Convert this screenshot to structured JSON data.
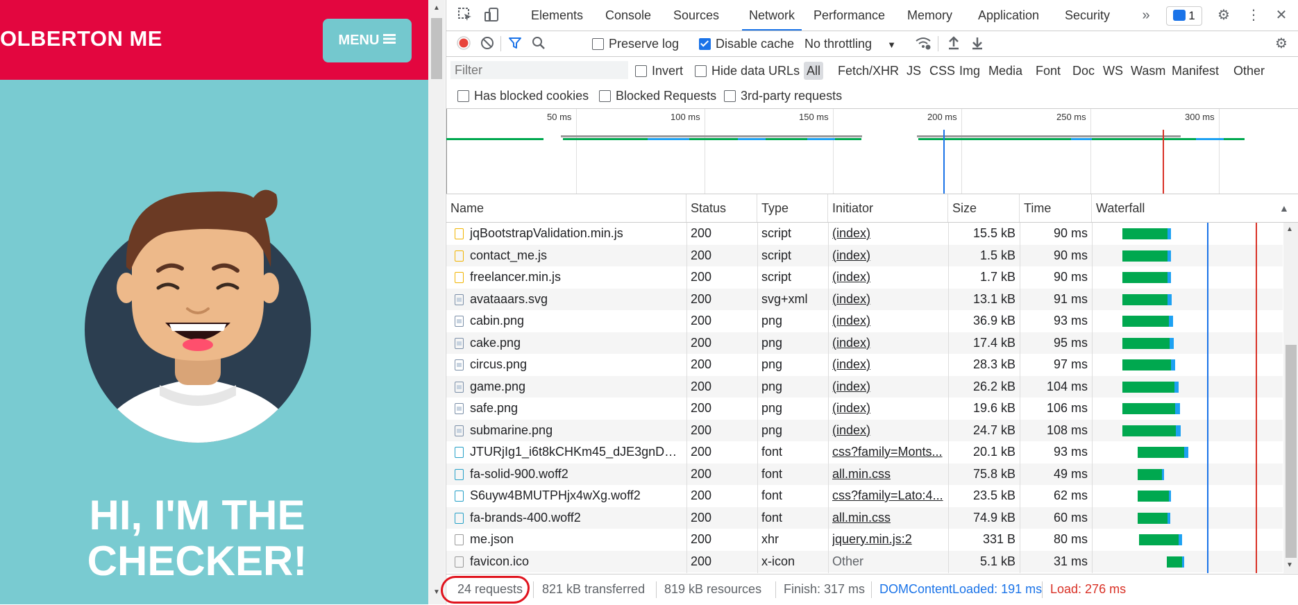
{
  "page": {
    "brand": "OLBERTON ME",
    "menu_label": "MENU",
    "hero_line1": "HI, I'M THE",
    "hero_line2": "CHECKER!",
    "colors": {
      "header": "#e3063f",
      "body": "#79cbd1",
      "menu_button": "#74c8ce"
    }
  },
  "devtools": {
    "tabs": [
      "Elements",
      "Console",
      "Sources",
      "Network",
      "Performance",
      "Memory",
      "Application",
      "Security"
    ],
    "active_tab": "Network",
    "issues_count": "1",
    "toolbar": {
      "preserve_log": "Preserve log",
      "disable_cache": "Disable cache",
      "throttling": "No throttling"
    },
    "filter": {
      "placeholder": "Filter",
      "invert": "Invert",
      "hide_data_urls": "Hide data URLs",
      "types": [
        "All",
        "Fetch/XHR",
        "JS",
        "CSS",
        "Img",
        "Media",
        "Font",
        "Doc",
        "WS",
        "Wasm",
        "Manifest",
        "Other"
      ],
      "active_type": "All",
      "has_blocked_cookies": "Has blocked cookies",
      "blocked_requests": "Blocked Requests",
      "third_party": "3rd-party requests"
    },
    "overview_ticks": [
      "50 ms",
      "100 ms",
      "150 ms",
      "200 ms",
      "250 ms",
      "300 ms"
    ],
    "columns": [
      "Name",
      "Status",
      "Type",
      "Initiator",
      "Size",
      "Time",
      "Waterfall"
    ],
    "rows": [
      {
        "name": "jqBootstrapValidation.min.js",
        "status": "200",
        "type": "script",
        "initiator": "(index)",
        "size": "15.5 kB",
        "time": "90 ms",
        "icon": "script-file-icon"
      },
      {
        "name": "contact_me.js",
        "status": "200",
        "type": "script",
        "initiator": "(index)",
        "size": "1.5 kB",
        "time": "90 ms",
        "icon": "script-file-icon"
      },
      {
        "name": "freelancer.min.js",
        "status": "200",
        "type": "script",
        "initiator": "(index)",
        "size": "1.7 kB",
        "time": "90 ms",
        "icon": "script-file-icon"
      },
      {
        "name": "avataaars.svg",
        "status": "200",
        "type": "svg+xml",
        "initiator": "(index)",
        "size": "13.1 kB",
        "time": "91 ms",
        "icon": "image-file-icon"
      },
      {
        "name": "cabin.png",
        "status": "200",
        "type": "png",
        "initiator": "(index)",
        "size": "36.9 kB",
        "time": "93 ms",
        "icon": "image-file-icon"
      },
      {
        "name": "cake.png",
        "status": "200",
        "type": "png",
        "initiator": "(index)",
        "size": "17.4 kB",
        "time": "95 ms",
        "icon": "image-file-icon"
      },
      {
        "name": "circus.png",
        "status": "200",
        "type": "png",
        "initiator": "(index)",
        "size": "28.3 kB",
        "time": "97 ms",
        "icon": "image-file-icon"
      },
      {
        "name": "game.png",
        "status": "200",
        "type": "png",
        "initiator": "(index)",
        "size": "26.2 kB",
        "time": "104 ms",
        "icon": "image-file-icon"
      },
      {
        "name": "safe.png",
        "status": "200",
        "type": "png",
        "initiator": "(index)",
        "size": "19.6 kB",
        "time": "106 ms",
        "icon": "image-file-icon"
      },
      {
        "name": "submarine.png",
        "status": "200",
        "type": "png",
        "initiator": "(index)",
        "size": "24.7 kB",
        "time": "108 ms",
        "icon": "image-file-icon"
      },
      {
        "name": "JTURjIg1_i6t8kCHKm45_dJE3gnD_g....",
        "status": "200",
        "type": "font",
        "initiator": "css?family=Monts...",
        "size": "20.1 kB",
        "time": "93 ms",
        "icon": "font-file-icon"
      },
      {
        "name": "fa-solid-900.woff2",
        "status": "200",
        "type": "font",
        "initiator": "all.min.css",
        "size": "75.8 kB",
        "time": "49 ms",
        "icon": "font-file-icon"
      },
      {
        "name": "S6uyw4BMUTPHjx4wXg.woff2",
        "status": "200",
        "type": "font",
        "initiator": "css?family=Lato:4...",
        "size": "23.5 kB",
        "time": "62 ms",
        "icon": "font-file-icon"
      },
      {
        "name": "fa-brands-400.woff2",
        "status": "200",
        "type": "font",
        "initiator": "all.min.css",
        "size": "74.9 kB",
        "time": "60 ms",
        "icon": "font-file-icon"
      },
      {
        "name": "me.json",
        "status": "200",
        "type": "xhr",
        "initiator": "jquery.min.js:2",
        "size": "331 B",
        "time": "80 ms",
        "icon": "file-icon"
      },
      {
        "name": "favicon.ico",
        "status": "200",
        "type": "x-icon",
        "initiator": "Other",
        "size": "5.1 kB",
        "time": "31 ms",
        "icon": "file-icon"
      }
    ],
    "status": {
      "requests": "24 requests",
      "transferred": "821 kB transferred",
      "resources": "819 kB resources",
      "finish": "Finish: 317 ms",
      "dom_content_loaded": "DOMContentLoaded: 191 ms",
      "load": "Load: 276 ms"
    },
    "colors": {
      "accent": "#1a73e8",
      "record": "#e8453c",
      "dcl": "#1a73e8",
      "load": "#d93025",
      "waiting": "#00a84f",
      "download": "#1da1f2"
    }
  }
}
